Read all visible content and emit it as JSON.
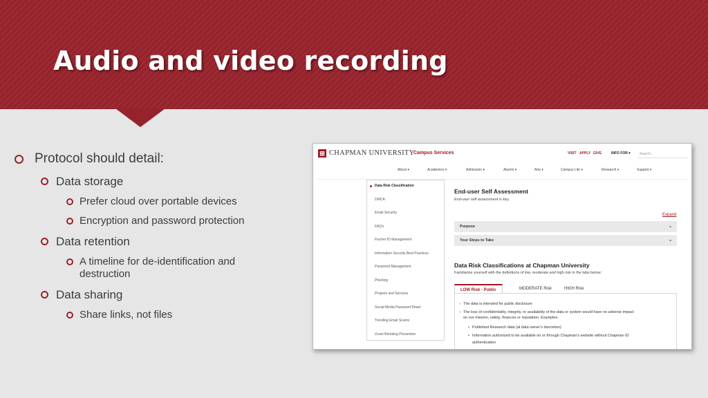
{
  "slide": {
    "title": "Audio and video recording",
    "bullets": [
      "Protocol should detail:",
      "Data storage",
      "Prefer cloud over portable devices",
      "Encryption and password protection",
      "Data retention",
      "A timeline for de-identification and",
      "destruction",
      "Data sharing",
      "Share links, not files"
    ]
  },
  "screenshot": {
    "logo_name": "CHAPMAN UNIVERSITY",
    "section": "Campus Services",
    "top_links": [
      "VISIT",
      "APPLY",
      "GIVE"
    ],
    "info_for": "INFO FOR ▾",
    "search_placeholder": "Search...",
    "nav": [
      "About ▾",
      "Academics ▾",
      "Admission ▾",
      "Alumni ▾",
      "Arts ▾",
      "Campus Life ▾",
      "Research ▾",
      "Support ▾"
    ],
    "sidebar": [
      "Data Risk Classification",
      "DMCA",
      "Email Security",
      "FAQ's",
      "Fischer ID Management",
      "Information Security Best Practices",
      "Password Management",
      "Phishing",
      "Projects and Services",
      "Social Media Password Reset",
      "Trending Email Scams",
      "Zoom Bombing Prevention"
    ],
    "self_assessment_title": "End-user Self Assessment",
    "self_assessment_sub": "End-user self assessment is key.",
    "expand_label": "Expand",
    "accordion": [
      "Purpose",
      "Your Steps to Take"
    ],
    "classifications_title": "Data Risk Classifications at Chapman University",
    "classifications_sub": "Familiarize yourself with the definitions of low, moderate and high risk in the tabs below:",
    "tabs": [
      "LOW Risk - Public",
      "MODERATE Risk",
      "HIGH Risk"
    ],
    "tab_content": [
      "The data is intended for public disclosure",
      "The loss of confidentiality, integrity, or availability of the data or system would have no adverse impact",
      "on our mission, safety, finances or reputation.  Examples:",
      "Published Research data (at data owner's discretion)",
      "Information authorized to be available on or through Chapman's website without Chapman ID",
      "authentication"
    ]
  },
  "colors": {
    "header": "#96222b",
    "accent": "#a4161f",
    "background": "#e6e6e6"
  }
}
